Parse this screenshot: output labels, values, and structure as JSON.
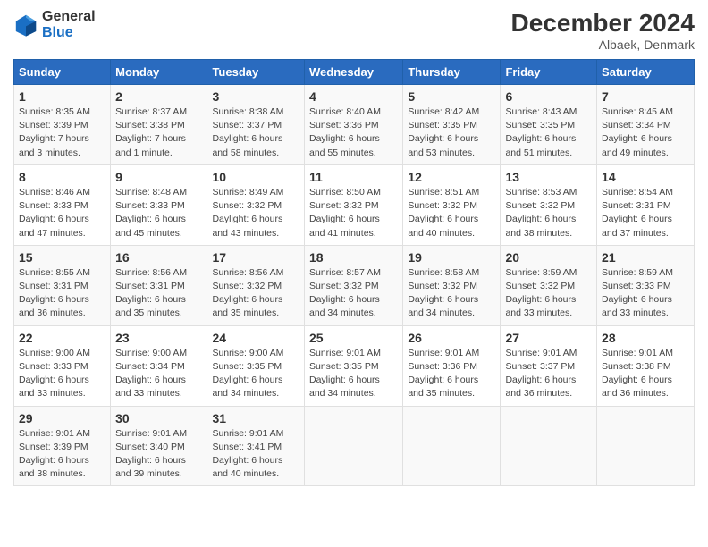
{
  "header": {
    "logo_line1": "General",
    "logo_line2": "Blue",
    "month": "December 2024",
    "location": "Albaek, Denmark"
  },
  "weekdays": [
    "Sunday",
    "Monday",
    "Tuesday",
    "Wednesday",
    "Thursday",
    "Friday",
    "Saturday"
  ],
  "weeks": [
    [
      {
        "day": "1",
        "info": "Sunrise: 8:35 AM\nSunset: 3:39 PM\nDaylight: 7 hours\nand 3 minutes."
      },
      {
        "day": "2",
        "info": "Sunrise: 8:37 AM\nSunset: 3:38 PM\nDaylight: 7 hours\nand 1 minute."
      },
      {
        "day": "3",
        "info": "Sunrise: 8:38 AM\nSunset: 3:37 PM\nDaylight: 6 hours\nand 58 minutes."
      },
      {
        "day": "4",
        "info": "Sunrise: 8:40 AM\nSunset: 3:36 PM\nDaylight: 6 hours\nand 55 minutes."
      },
      {
        "day": "5",
        "info": "Sunrise: 8:42 AM\nSunset: 3:35 PM\nDaylight: 6 hours\nand 53 minutes."
      },
      {
        "day": "6",
        "info": "Sunrise: 8:43 AM\nSunset: 3:35 PM\nDaylight: 6 hours\nand 51 minutes."
      },
      {
        "day": "7",
        "info": "Sunrise: 8:45 AM\nSunset: 3:34 PM\nDaylight: 6 hours\nand 49 minutes."
      }
    ],
    [
      {
        "day": "8",
        "info": "Sunrise: 8:46 AM\nSunset: 3:33 PM\nDaylight: 6 hours\nand 47 minutes."
      },
      {
        "day": "9",
        "info": "Sunrise: 8:48 AM\nSunset: 3:33 PM\nDaylight: 6 hours\nand 45 minutes."
      },
      {
        "day": "10",
        "info": "Sunrise: 8:49 AM\nSunset: 3:32 PM\nDaylight: 6 hours\nand 43 minutes."
      },
      {
        "day": "11",
        "info": "Sunrise: 8:50 AM\nSunset: 3:32 PM\nDaylight: 6 hours\nand 41 minutes."
      },
      {
        "day": "12",
        "info": "Sunrise: 8:51 AM\nSunset: 3:32 PM\nDaylight: 6 hours\nand 40 minutes."
      },
      {
        "day": "13",
        "info": "Sunrise: 8:53 AM\nSunset: 3:32 PM\nDaylight: 6 hours\nand 38 minutes."
      },
      {
        "day": "14",
        "info": "Sunrise: 8:54 AM\nSunset: 3:31 PM\nDaylight: 6 hours\nand 37 minutes."
      }
    ],
    [
      {
        "day": "15",
        "info": "Sunrise: 8:55 AM\nSunset: 3:31 PM\nDaylight: 6 hours\nand 36 minutes."
      },
      {
        "day": "16",
        "info": "Sunrise: 8:56 AM\nSunset: 3:31 PM\nDaylight: 6 hours\nand 35 minutes."
      },
      {
        "day": "17",
        "info": "Sunrise: 8:56 AM\nSunset: 3:32 PM\nDaylight: 6 hours\nand 35 minutes."
      },
      {
        "day": "18",
        "info": "Sunrise: 8:57 AM\nSunset: 3:32 PM\nDaylight: 6 hours\nand 34 minutes."
      },
      {
        "day": "19",
        "info": "Sunrise: 8:58 AM\nSunset: 3:32 PM\nDaylight: 6 hours\nand 34 minutes."
      },
      {
        "day": "20",
        "info": "Sunrise: 8:59 AM\nSunset: 3:32 PM\nDaylight: 6 hours\nand 33 minutes."
      },
      {
        "day": "21",
        "info": "Sunrise: 8:59 AM\nSunset: 3:33 PM\nDaylight: 6 hours\nand 33 minutes."
      }
    ],
    [
      {
        "day": "22",
        "info": "Sunrise: 9:00 AM\nSunset: 3:33 PM\nDaylight: 6 hours\nand 33 minutes."
      },
      {
        "day": "23",
        "info": "Sunrise: 9:00 AM\nSunset: 3:34 PM\nDaylight: 6 hours\nand 33 minutes."
      },
      {
        "day": "24",
        "info": "Sunrise: 9:00 AM\nSunset: 3:35 PM\nDaylight: 6 hours\nand 34 minutes."
      },
      {
        "day": "25",
        "info": "Sunrise: 9:01 AM\nSunset: 3:35 PM\nDaylight: 6 hours\nand 34 minutes."
      },
      {
        "day": "26",
        "info": "Sunrise: 9:01 AM\nSunset: 3:36 PM\nDaylight: 6 hours\nand 35 minutes."
      },
      {
        "day": "27",
        "info": "Sunrise: 9:01 AM\nSunset: 3:37 PM\nDaylight: 6 hours\nand 36 minutes."
      },
      {
        "day": "28",
        "info": "Sunrise: 9:01 AM\nSunset: 3:38 PM\nDaylight: 6 hours\nand 36 minutes."
      }
    ],
    [
      {
        "day": "29",
        "info": "Sunrise: 9:01 AM\nSunset: 3:39 PM\nDaylight: 6 hours\nand 38 minutes."
      },
      {
        "day": "30",
        "info": "Sunrise: 9:01 AM\nSunset: 3:40 PM\nDaylight: 6 hours\nand 39 minutes."
      },
      {
        "day": "31",
        "info": "Sunrise: 9:01 AM\nSunset: 3:41 PM\nDaylight: 6 hours\nand 40 minutes."
      },
      null,
      null,
      null,
      null
    ]
  ]
}
